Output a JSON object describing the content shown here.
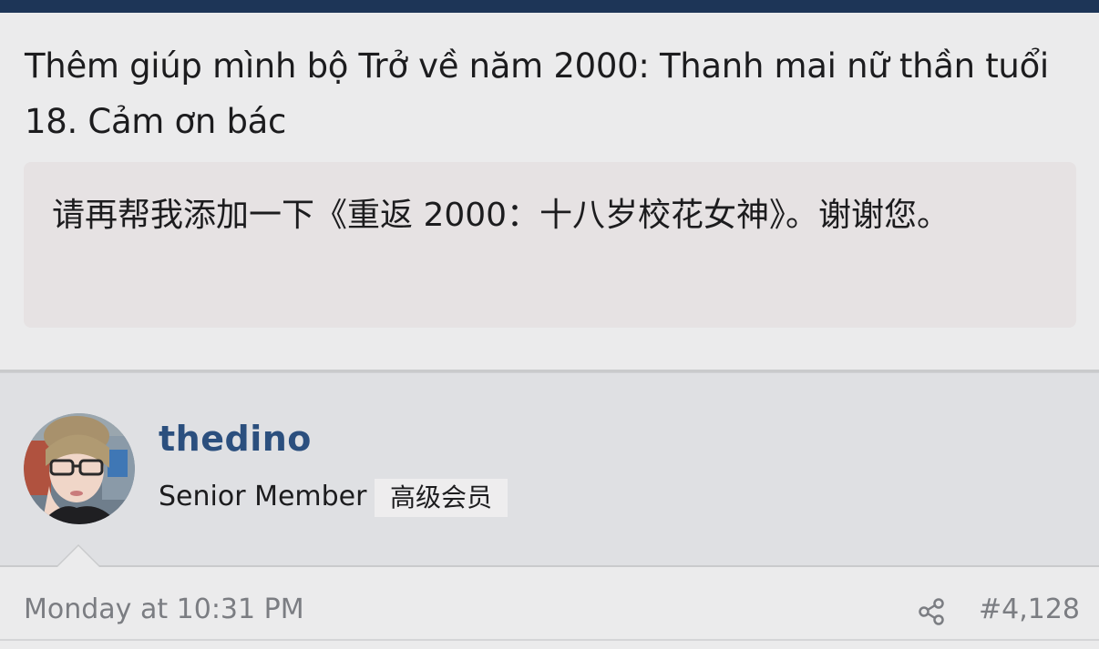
{
  "post": {
    "message": "Thêm giúp mình bộ Trở về năm 2000: Thanh mai nữ thần tuổi 18. Cảm ơn bác",
    "quote": "请再帮我添加一下《重返 2000：十八岁校花女神》。谢谢您。"
  },
  "author": {
    "username": "thedino",
    "title": "Senior Member",
    "badge": "高级会员"
  },
  "footer": {
    "date": "Monday at 10:31 PM",
    "post_number": "#4,128",
    "share_icon": "share-icon"
  },
  "colors": {
    "topbar": "#1d3557",
    "username": "#2b4f7e",
    "meta_text": "#7b7d82"
  }
}
